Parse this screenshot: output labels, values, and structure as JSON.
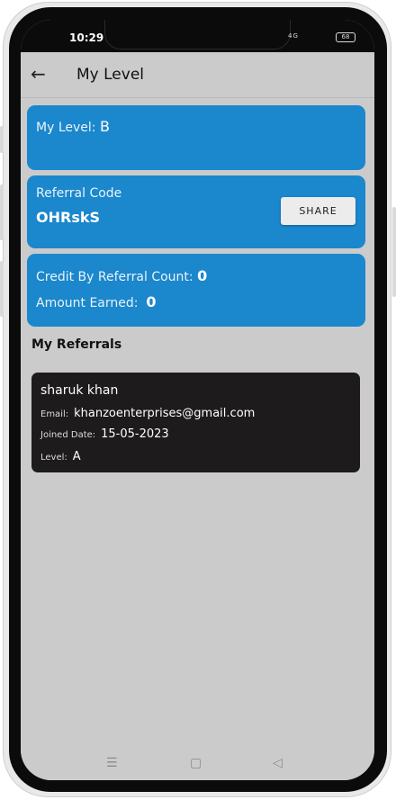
{
  "status": {
    "time": "10:29",
    "signal": "4G",
    "battery": "68"
  },
  "appbar": {
    "title": "My Level"
  },
  "level_card": {
    "label": "My Level:",
    "value": "B"
  },
  "referral_card": {
    "label": "Referral Code",
    "code": "OHRskS",
    "share_label": "SHARE"
  },
  "credit_card": {
    "credit_label": "Credit By Referral Count:",
    "credit_value": "0",
    "amount_label": "Amount Earned:",
    "amount_value": "0"
  },
  "referrals": {
    "title": "My Referrals",
    "items": [
      {
        "name": "sharuk khan",
        "email_label": "Email:",
        "email": "khanzoenterprises@gmail.com",
        "joined_label": "Joined Date:",
        "joined": "15-05-2023",
        "level_label": "Level:",
        "level": "A"
      }
    ]
  },
  "navbar": {
    "menu_icon": "menu-icon",
    "home_icon": "home-icon",
    "back_icon": "back-triangle-icon"
  },
  "colors": {
    "card_blue": "#1b87cc",
    "referral_card": "#1d1b1c",
    "screen_bg": "#cbcbcc"
  }
}
